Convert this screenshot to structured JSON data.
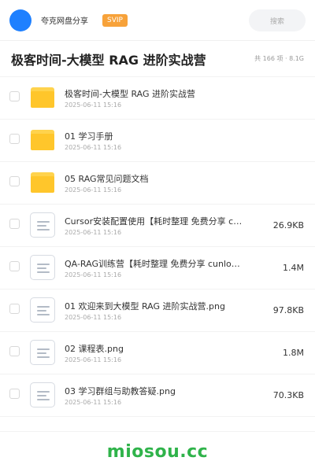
{
  "header": {
    "app_name": "夸克网盘分享",
    "badge": "SVIP",
    "search_label": "搜索",
    "accent": "#1e80ff",
    "badge_color": "#f7a23a"
  },
  "title": {
    "text": "极客时间-大模型 RAG 进阶实战营",
    "meta": "共 166 项 · 8.1G"
  },
  "files": [
    {
      "type": "folder",
      "icon": "folder-icon",
      "name": "极客时间-大模型 RAG 进阶实战营",
      "date": "2025-06-11 15:16",
      "size": ""
    },
    {
      "type": "folder",
      "icon": "folder-icon",
      "name": "01 学习手册",
      "date": "2025-06-11 15:16",
      "size": ""
    },
    {
      "type": "folder",
      "icon": "folder-icon",
      "name": "05 RAG常见问题文档",
      "date": "2025-06-11 15:16",
      "size": ""
    },
    {
      "type": "file",
      "icon": "document-icon",
      "name": "Cursor安装配置使用【耗时整理 免费分享 cu…",
      "date": "2025-06-11 15:16",
      "size": "26.9KB"
    },
    {
      "type": "file",
      "icon": "document-icon",
      "name": "QA-RAG训练营【耗时整理 免费分享 cunlo…",
      "date": "2025-06-11 15:16",
      "size": "1.4M"
    },
    {
      "type": "file",
      "icon": "document-icon",
      "name": "01 欢迎来到大模型 RAG 进阶实战营.png",
      "date": "2025-06-11 15:16",
      "size": "97.8KB"
    },
    {
      "type": "file",
      "icon": "document-icon",
      "name": "02 课程表.png",
      "date": "2025-06-11 15:16",
      "size": "1.8M"
    },
    {
      "type": "file",
      "icon": "document-icon",
      "name": "03 学习群组与助教答疑.png",
      "date": "2025-06-11 15:16",
      "size": "70.3KB"
    }
  ],
  "footer": {
    "watermark": "miosou.cc",
    "color": "#2fb34a"
  }
}
